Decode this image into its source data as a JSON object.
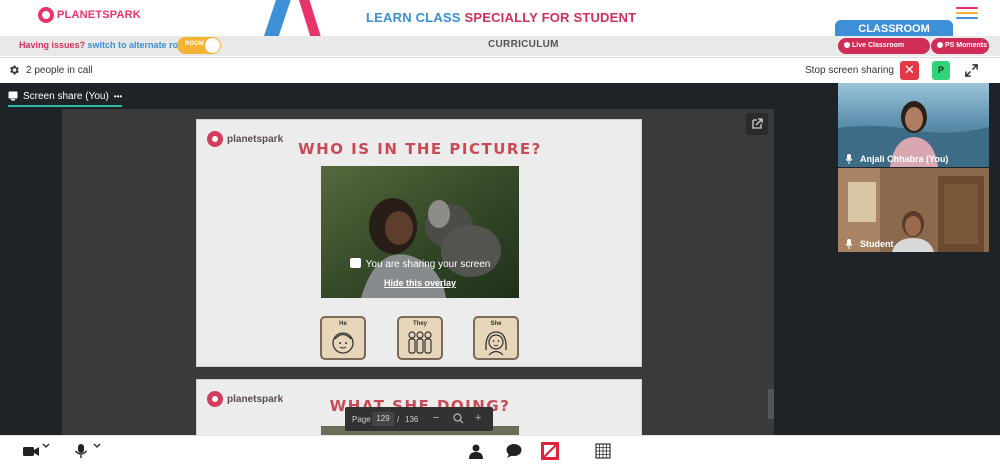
{
  "header": {
    "logo_text": "PLANETSPARK",
    "banner_part1": "LEARN CLASS ",
    "banner_part2": "SPECIALLY FOR STUDENT",
    "classroom_label": "CLASSROOM"
  },
  "subbar": {
    "issue_text": "Having issues?",
    "switch_text": "switch to alternate room",
    "room_toggle_label": "ROOM",
    "curriculum_label": "CURRICULUM",
    "live_support_label": "Live Classroom Support",
    "ps_moments_label": "PS Moments"
  },
  "call": {
    "people_count": "2 people in call",
    "stop_sharing": "Stop screen sharing",
    "avatar_initial": "P"
  },
  "stage": {
    "tab_label": "Screen share (You)",
    "tab_more": "•••",
    "sharing_message": "You are sharing your screen",
    "hide_overlay": "Hide this overlay",
    "page_label": "Page",
    "page_current": "129",
    "page_separator": "/",
    "page_total": "136"
  },
  "slides": [
    {
      "logo": "planetspark",
      "title": "WHO IS IN THE PICTURE?",
      "choices": [
        "He",
        "They",
        "She"
      ]
    },
    {
      "logo": "planetspark",
      "title": "WHAT      SHE DOING?"
    }
  ],
  "participants": [
    {
      "name": "Anjali Chhabra (You)"
    },
    {
      "name": "Student"
    }
  ],
  "colors": {
    "brand_pink": "#d2305a",
    "brand_blue": "#3a8fd6",
    "stop_red": "#e53945",
    "avatar_green": "#2fd478",
    "accent_teal": "#2fb9a5"
  },
  "icons": {
    "settings": "gear-icon",
    "stop": "close-icon",
    "fullscreen": "expand-icon",
    "present": "present-icon",
    "camera": "camera-icon",
    "mic": "microphone-icon",
    "people": "person-icon",
    "chat": "chat-icon",
    "share": "screen-share-off-icon",
    "activities": "grid-icon"
  }
}
